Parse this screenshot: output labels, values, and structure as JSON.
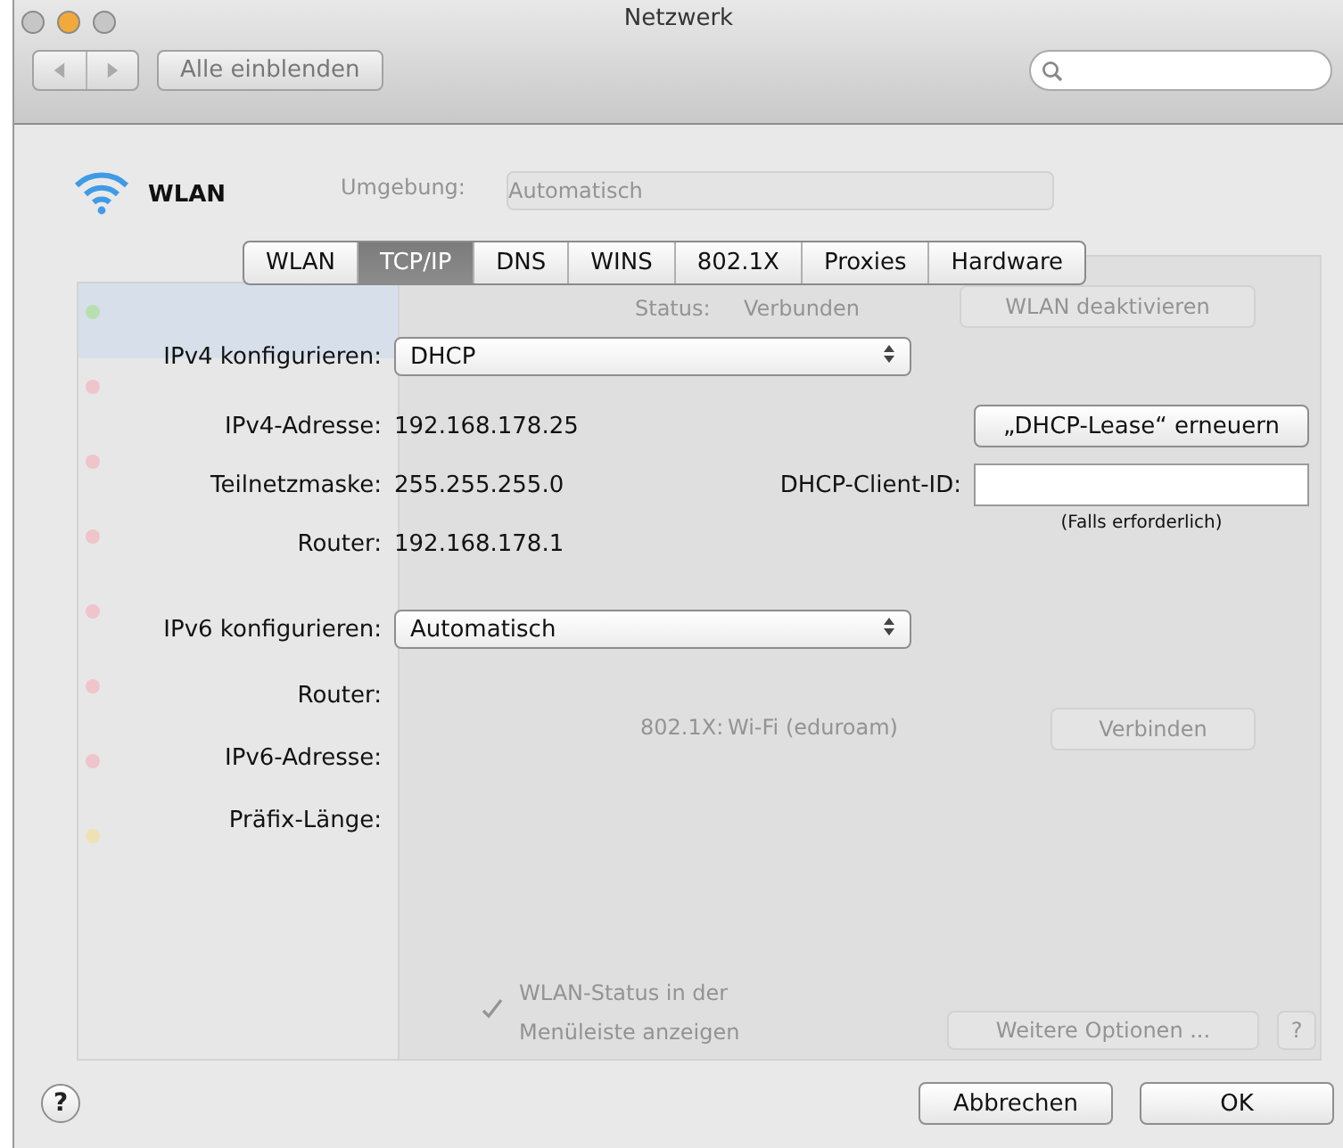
{
  "window": {
    "title": "Netzwerk"
  },
  "toolbar": {
    "show_all_button": "Alle einblenden"
  },
  "service": {
    "name": "WLAN"
  },
  "background": {
    "location_label": "Umgebung:",
    "location_value": "Automatisch",
    "status_label": "Status:",
    "status_value": "Verbunden",
    "disable_button": "WLAN deaktivieren",
    "eap_label": "802.1X:",
    "eap_value": "Wi-Fi (eduroam)",
    "connect_button": "Verbinden",
    "menu_bar_option": {
      "label": "WLAN-Status in der Menüleiste anzeigen",
      "checked": true
    },
    "more_options_button": "Weitere Optionen ...",
    "help_button": "?",
    "services": [
      {
        "color": "#b8dfb0",
        "selected": true
      },
      {
        "color": "#efc4ca",
        "selected": false
      },
      {
        "color": "#efc4ca",
        "selected": false
      },
      {
        "color": "#efc4ca",
        "selected": false
      },
      {
        "color": "#efc4ca",
        "selected": false
      },
      {
        "color": "#efc4ca",
        "selected": false
      },
      {
        "color": "#efc4ca",
        "selected": false
      },
      {
        "color": "#efe2b2",
        "selected": false
      }
    ]
  },
  "tabs": [
    {
      "label": "WLAN",
      "selected": false
    },
    {
      "label": "TCP/IP",
      "selected": true
    },
    {
      "label": "DNS",
      "selected": false
    },
    {
      "label": "WINS",
      "selected": false
    },
    {
      "label": "802.1X",
      "selected": false
    },
    {
      "label": "Proxies",
      "selected": false
    },
    {
      "label": "Hardware",
      "selected": false
    }
  ],
  "ipv4": {
    "configure_label": "IPv4 konfigurieren:",
    "configure_value": "DHCP",
    "fields": [
      {
        "label": "IPv4-Adresse:",
        "value": "192.168.178.25"
      },
      {
        "label": "Teilnetzmaske:",
        "value": "255.255.255.0"
      },
      {
        "label": "Router:",
        "value": "192.168.178.1"
      }
    ],
    "renew_button": "„DHCP-Lease“ erneuern",
    "client_id": {
      "label": "DHCP-Client-ID:",
      "hint": "(Falls erforderlich)"
    }
  },
  "ipv6": {
    "configure_label": "IPv6 konfigurieren:",
    "configure_value": "Automatisch",
    "fields": [
      {
        "label": "Router:"
      },
      {
        "label": "IPv6-Adresse:"
      },
      {
        "label": "Präfix-Länge:"
      }
    ]
  },
  "help": "?",
  "buttons": [
    {
      "label": "Abbrechen",
      "default": false
    },
    {
      "label": "OK",
      "default": false
    }
  ]
}
